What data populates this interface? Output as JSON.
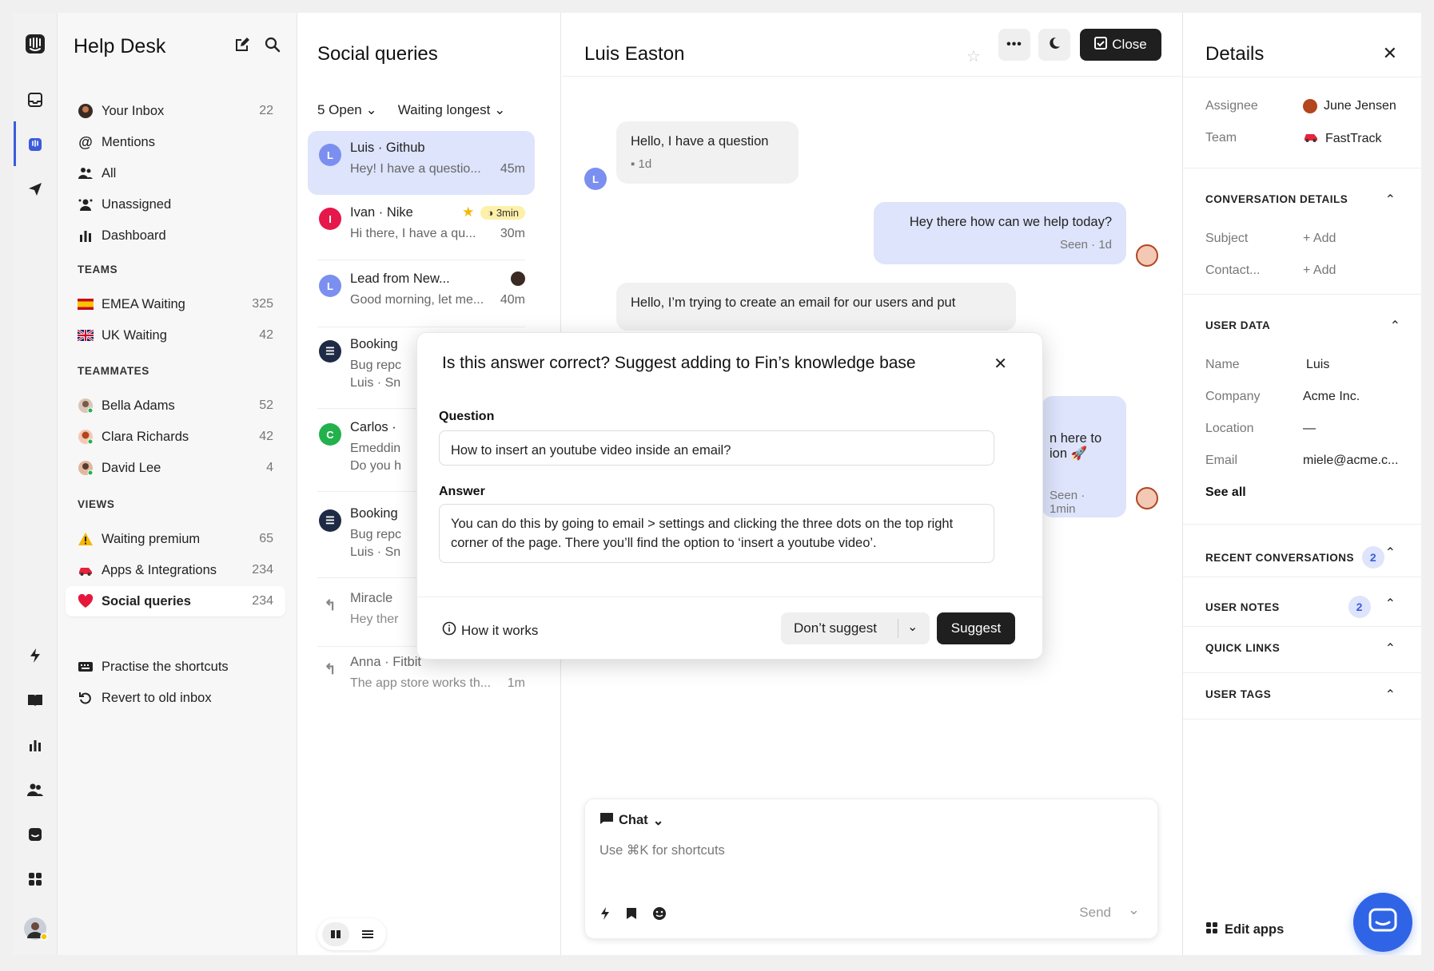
{
  "nav": {
    "title": "Help Desk",
    "items": [
      {
        "label": "Your Inbox",
        "count": "22"
      },
      {
        "label": "Mentions",
        "count": ""
      },
      {
        "label": "All",
        "count": ""
      },
      {
        "label": "Unassigned",
        "count": ""
      },
      {
        "label": "Dashboard",
        "count": ""
      }
    ],
    "teams_header": "TEAMS",
    "teams": [
      {
        "label": "EMEA Waiting",
        "count": "325"
      },
      {
        "label": "UK Waiting",
        "count": "42"
      }
    ],
    "teammates_header": "TEAMMATES",
    "teammates": [
      {
        "label": "Bella Adams",
        "count": "52"
      },
      {
        "label": "Clara Richards",
        "count": "42"
      },
      {
        "label": "David Lee",
        "count": "4"
      }
    ],
    "views_header": "VIEWS",
    "views": [
      {
        "label": "Waiting premium",
        "count": "65"
      },
      {
        "label": "Apps & Integrations",
        "count": "234"
      },
      {
        "label": "Social queries",
        "count": "234"
      }
    ],
    "footer": [
      {
        "label": "Practise the shortcuts"
      },
      {
        "label": "Revert to old inbox"
      }
    ]
  },
  "list": {
    "title": "Social queries",
    "filter_open": "5 Open",
    "filter_sort": "Waiting longest",
    "conversations": [
      {
        "initial": "L",
        "name": "Luis · Github",
        "preview": "Hey! I have a questio...",
        "time": "45m",
        "color": "#7b8ff0"
      },
      {
        "initial": "I",
        "name": "Ivan · Nike",
        "preview": "Hi there, I have a qu...",
        "time": "30m",
        "color": "#e5174b",
        "sla": "3min"
      },
      {
        "initial": "L",
        "name": "Lead from New...",
        "preview": "Good morning, let me...",
        "time": "40m",
        "color": "#7b8ff0"
      },
      {
        "initial": "",
        "name": "Booking",
        "preview": "Bug repc",
        "preview2": "Luis · Sn",
        "time": "",
        "color": "#1f2a44"
      },
      {
        "initial": "C",
        "name": "Carlos ·",
        "preview": "Emeddin",
        "preview2": "Do you h",
        "time": "",
        "color": "#22b14c"
      },
      {
        "initial": "",
        "name": "Booking",
        "preview": "Bug repc",
        "preview2": "Luis · Sn",
        "time": "",
        "color": "#1f2a44"
      },
      {
        "initial": "",
        "name": "Miracle",
        "preview": "Hey ther",
        "time": "",
        "color": "#fff"
      },
      {
        "initial": "",
        "name": "Anna · Fitbit",
        "preview": "The app store works th...",
        "time": "1m",
        "color": "#fff"
      }
    ]
  },
  "chat": {
    "title": "Luis Easton",
    "close_label": "Close",
    "messages": [
      {
        "text": "Hello, I have a question",
        "meta": "1d"
      },
      {
        "text": "Hey there how can we help today?",
        "meta": "Seen · 1d"
      },
      {
        "text": "Hello, I’m trying to create an email for our users and put"
      },
      {
        "text1": "n here to",
        "text2": "ion 🚀",
        "meta": "Seen · 1min"
      }
    ],
    "composer": {
      "mode": "Chat",
      "placeholder": "Use ⌘K for shortcuts",
      "send": "Send"
    }
  },
  "modal": {
    "title": "Is this answer correct? Suggest adding to Fin’s knowledge base",
    "question_label": "Question",
    "question": "How to insert an youtube video inside an email?",
    "answer_label": "Answer",
    "answer": "You can do this by going to email > settings and clicking the three dots on the top right corner of the page. There you’ll find the option to ‘insert a youtube video’.",
    "how_it_works": "How it works",
    "dont_suggest": "Don’t suggest",
    "suggest": "Suggest"
  },
  "details": {
    "title": "Details",
    "assignee_label": "Assignee",
    "assignee": "June Jensen",
    "team_label": "Team",
    "team": "FastTrack",
    "conv_details": "CONVERSATION DETAILS",
    "subject_label": "Subject",
    "subject_value": "+ Add",
    "contact_label": "Contact...",
    "contact_value": "+ Add",
    "user_data": "USER DATA",
    "name_label": "Name",
    "name": "Luis",
    "company_label": "Company",
    "company": "Acme Inc.",
    "location_label": "Location",
    "location": "—",
    "email_label": "Email",
    "email": "miele@acme.c...",
    "see_all": "See all",
    "recent": "RECENT CONVERSATIONS",
    "recent_count": "2",
    "notes": "USER NOTES",
    "notes_count": "2",
    "quick_links": "QUICK LINKS",
    "user_tags": "USER TAGS",
    "edit_apps": "Edit apps"
  }
}
